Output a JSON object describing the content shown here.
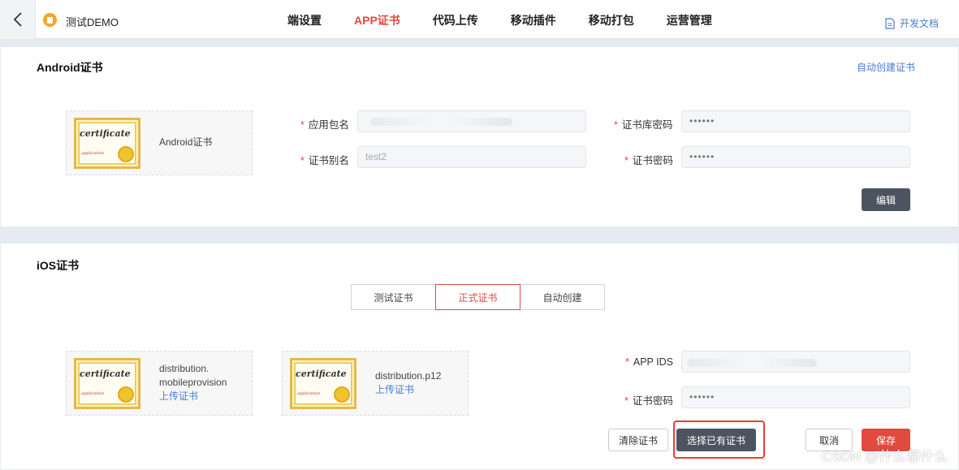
{
  "header": {
    "app_name": "测试DEMO",
    "nav": [
      "端设置",
      "APP证书",
      "代码上传",
      "移动插件",
      "移动打包",
      "运营管理"
    ],
    "active_nav": "APP证书",
    "docs_label": "开发文档"
  },
  "android": {
    "title": "Android证书",
    "auto_create_link": "自动创建证书",
    "cert_card_label": "Android证书",
    "package_name_label": "应用包名",
    "package_name_value": "",
    "alias_label": "证书别名",
    "alias_value": "test2",
    "keystore_password_label": "证书库密码",
    "keystore_password_value": "••••••",
    "cert_password_label": "证书密码",
    "cert_password_value": "••••••",
    "edit_button": "编辑"
  },
  "ios": {
    "title": "iOS证书",
    "tabs": [
      "测试证书",
      "正式证书",
      "自动创建"
    ],
    "active_tab": "正式证书",
    "cards": [
      {
        "filename_line1": "distribution.",
        "filename_line2": "mobileprovision",
        "upload_link": "上传证书"
      },
      {
        "filename_line1": "distribution.p12",
        "filename_line2": "",
        "upload_link": "上传证书"
      }
    ],
    "app_ids_label": "APP IDS",
    "app_ids_value": "",
    "cert_password_label": "证书密码",
    "cert_password_value": "••••••",
    "clear_button": "清除证书",
    "select_button": "选择已有证书",
    "cancel_button": "取消",
    "save_button": "保存"
  },
  "cert_image": {
    "word": "certificate",
    "sub": "application"
  },
  "watermark": "CSDN @什么都什么",
  "colors": {
    "accent": "#e04a3f",
    "link": "#4a7dd1",
    "dark_button": "#4d5461"
  }
}
